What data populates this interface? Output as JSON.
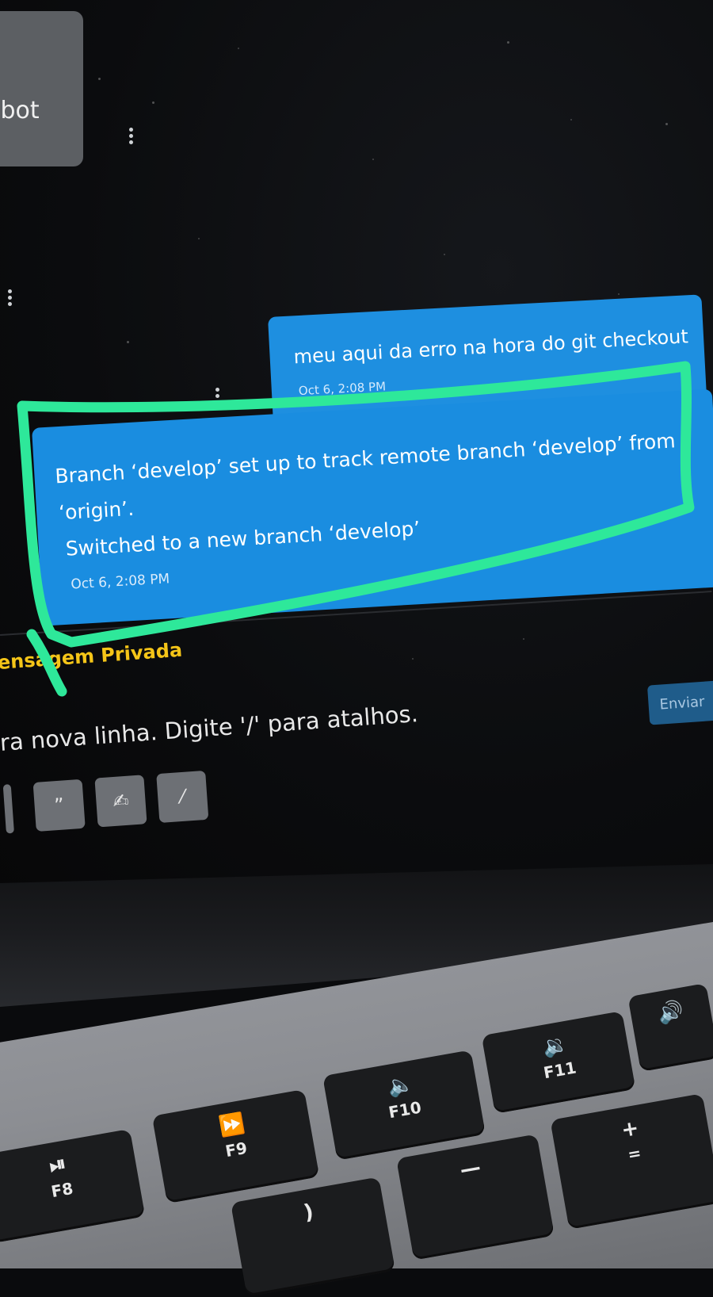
{
  "bot_message": {
    "label_fragment": "ebot"
  },
  "messages": [
    {
      "id": "top",
      "text": "meu aqui da erro na hora do git checkout",
      "time": "Oct 6, 2:08 PM"
    },
    {
      "id": "main",
      "lines": [
        "Branch ‘develop’ set up to track remote branch ‘develop’ from",
        "‘origin’.",
        "Switched to a new branch ‘develop’"
      ],
      "time": "Oct 6, 2:08 PM"
    }
  ],
  "composer": {
    "mode_label": "ensagem Privada",
    "placeholder": "ra nova linha. Digite '/' para atalhos.",
    "send_label": "Enviar",
    "tools": [
      {
        "icon": "quote-icon",
        "glyph": "”"
      },
      {
        "icon": "signature-icon",
        "glyph": "✍"
      },
      {
        "icon": "magic-wand-icon",
        "glyph": "⁄"
      }
    ]
  },
  "keyboard": {
    "keys": [
      {
        "icon": "play-pause-icon",
        "symbol": "⏯",
        "label": "F8"
      },
      {
        "icon": "fast-forward-icon",
        "symbol": "⏩",
        "label": "F9"
      },
      {
        "icon": "volume-mute-icon",
        "symbol": "🔈",
        "label": "F10"
      },
      {
        "icon": "volume-down-icon",
        "symbol": "🔉",
        "label": "F11"
      },
      {
        "icon": "volume-up-icon",
        "symbol": "🔊",
        "label": ""
      },
      {
        "icon": "paren-key",
        "symbol": ")",
        "label": ""
      },
      {
        "icon": "minus-key",
        "symbol": "—",
        "label": ""
      },
      {
        "icon": "plus-equals-key",
        "symbol": "+",
        "label": "="
      }
    ]
  },
  "colors": {
    "bubble_blue": "#1a8de0",
    "highlight_green": "#2ee89a",
    "private_yellow": "#f5c518"
  }
}
